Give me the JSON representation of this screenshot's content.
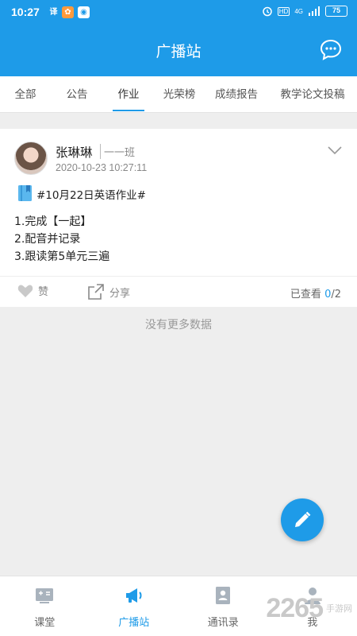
{
  "statusbar": {
    "time": "10:27",
    "network": "4G",
    "battery": "75",
    "hd": "HD"
  },
  "header": {
    "title": "广播站"
  },
  "tabs": [
    {
      "label": "全部"
    },
    {
      "label": "公告"
    },
    {
      "label": "作业",
      "active": true
    },
    {
      "label": "光荣榜"
    },
    {
      "label": "成绩报告"
    },
    {
      "label": "教学论文投稿"
    }
  ],
  "post": {
    "author": "张琳琳",
    "class": "一一班",
    "time": "2020-10-23 10:27:11",
    "subject": "#10月22日英语作业#",
    "lines": [
      "1.完成【一起】",
      "2.配音并记录",
      "3.跟读第5单元三遍"
    ],
    "like_label": "赞",
    "share_label": "分享",
    "viewed_label": "已查看",
    "viewed_count": "0",
    "viewed_total": "/2"
  },
  "list_end_text": "没有更多数据",
  "bottom_nav": [
    {
      "label": "课堂"
    },
    {
      "label": "广播站",
      "active": true
    },
    {
      "label": "通讯录"
    },
    {
      "label": "我"
    }
  ],
  "watermark": {
    "number": "2265",
    "text": "手游网"
  },
  "colors": {
    "accent": "#1e9be8"
  }
}
